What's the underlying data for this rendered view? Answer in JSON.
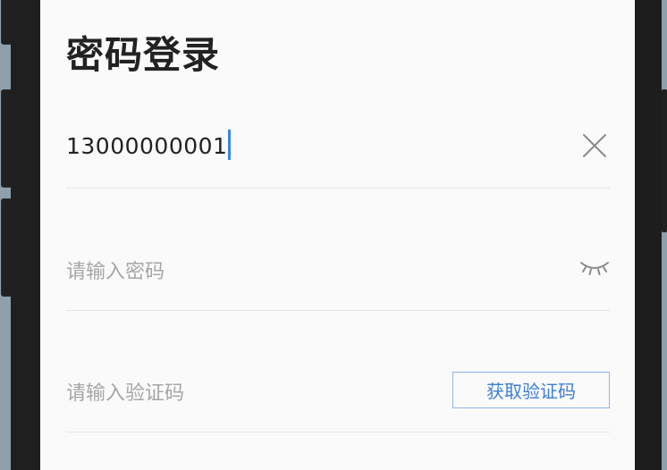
{
  "login": {
    "title": "密码登录",
    "phone_value": "13000000001",
    "password_placeholder": "请输入密码",
    "code_placeholder": "请输入验证码",
    "get_code_label": "获取验证码"
  },
  "icons": {
    "clear": "close-icon",
    "password_visibility": "eye-closed-icon"
  },
  "colors": {
    "accent": "#3d7fd8",
    "button_border": "#8db4ee",
    "title_text": "#222222",
    "placeholder_text": "#a6a6a6",
    "divider": "#e6e6e6",
    "screen_background": "#fafafa"
  }
}
